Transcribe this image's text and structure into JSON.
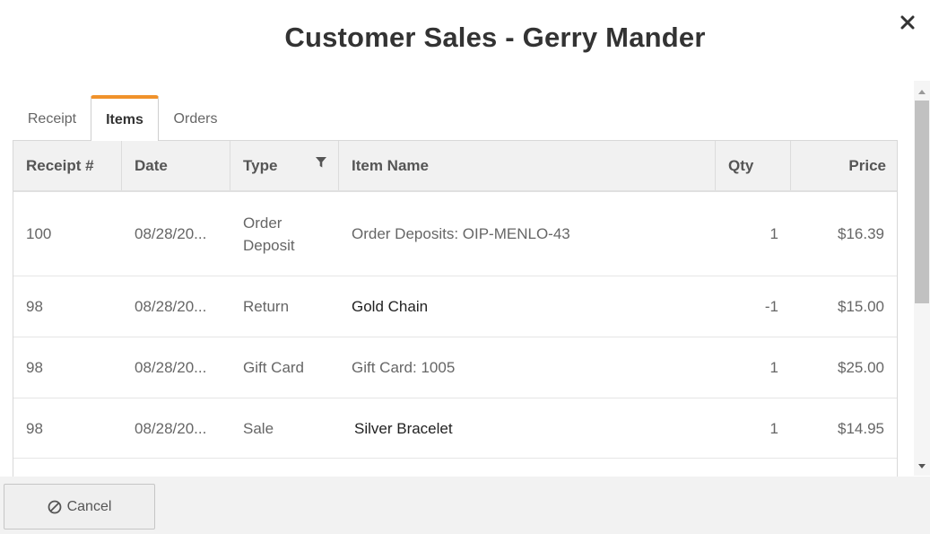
{
  "dialog": {
    "title": "Customer Sales - Gerry Mander"
  },
  "tabs": [
    {
      "label": "Receipt",
      "active": false
    },
    {
      "label": "Items",
      "active": true
    },
    {
      "label": "Orders",
      "active": false
    }
  ],
  "grid": {
    "columns": [
      "Receipt #",
      "Date",
      "Type",
      "Item Name",
      "Qty",
      "Price"
    ],
    "rows": [
      {
        "receipt": "100",
        "date": "08/28/20...",
        "type": "Order Deposit",
        "item": "Order Deposits: OIP-MENLO-43",
        "qty": "1",
        "price": "$16.39"
      },
      {
        "receipt": "98",
        "date": "08/28/20...",
        "type": "Return",
        "item": "Gold Chain",
        "qty": "-1",
        "price": "$15.00"
      },
      {
        "receipt": "98",
        "date": "08/28/20...",
        "type": "Gift Card",
        "item": "Gift Card: 1005",
        "qty": "1",
        "price": "$25.00"
      },
      {
        "receipt": "98",
        "date": "08/28/20...",
        "type": "Sale",
        "item": "Silver Bracelet",
        "qty": "1",
        "price": "$14.95"
      }
    ]
  },
  "footer": {
    "cancel_label": "Cancel"
  },
  "colors": {
    "accent_tab": "#f0922b",
    "header_bg": "#f1f1f1",
    "footer_bg": "#f2f2f2"
  },
  "icons": {
    "close": "close-icon",
    "filter": "filter-icon",
    "cancel": "cancel-icon"
  }
}
